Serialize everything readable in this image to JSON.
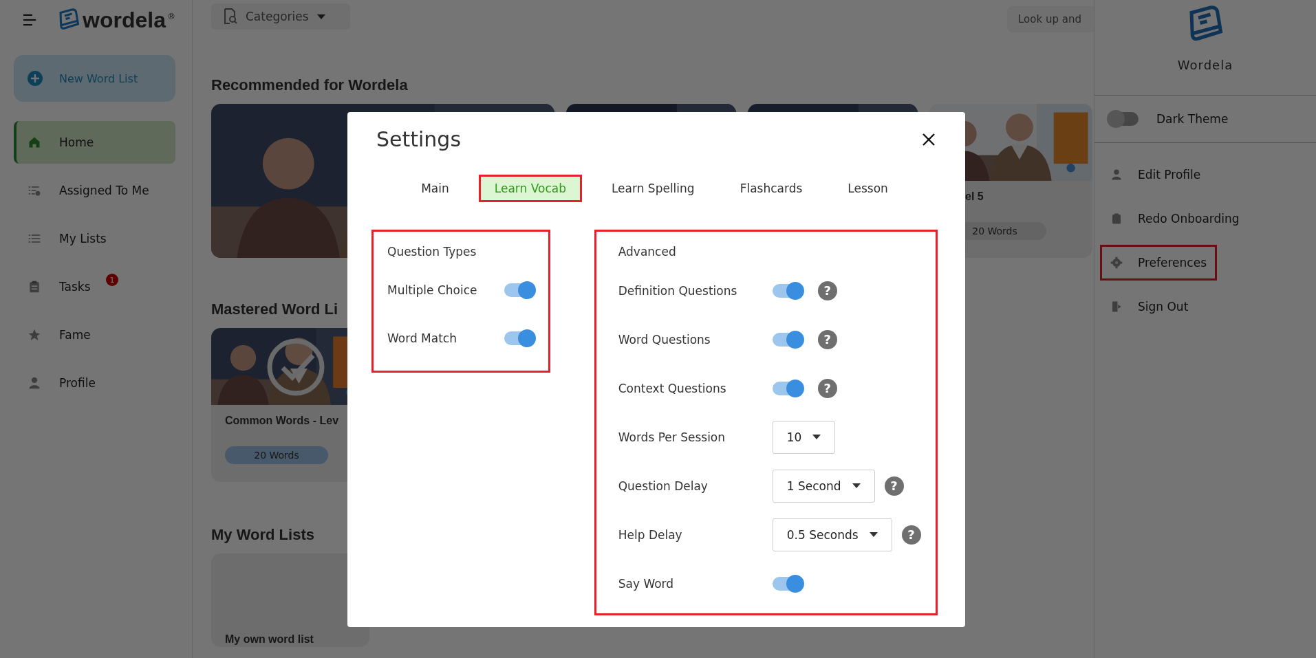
{
  "sidebar": {
    "logo_text": "wordela",
    "logo_mark": "®",
    "new_button": "New Word List",
    "items": [
      {
        "label": "Home",
        "selected": true
      },
      {
        "label": "Assigned To Me",
        "selected": false
      },
      {
        "label": "My Lists",
        "selected": false
      },
      {
        "label": "Tasks",
        "selected": false,
        "badge": "1"
      },
      {
        "label": "Fame",
        "selected": false
      },
      {
        "label": "Profile",
        "selected": false
      }
    ]
  },
  "top_bar": {
    "categories": "Categories",
    "search_placeholder": "Look up and"
  },
  "sections": [
    {
      "heading": "Recommended for Wordela",
      "cards": [
        {
          "kind": "picture"
        },
        {
          "kind": "picture"
        },
        {
          "kind": "picture"
        },
        {
          "kind": "picture",
          "title": "el 5",
          "count": "20 Words"
        }
      ]
    },
    {
      "heading": "Mastered Word Li",
      "cards": [
        {
          "kind": "picture",
          "title": "Common Words - Lev",
          "count": "20 Words",
          "mastered": true
        }
      ]
    },
    {
      "heading": "My Word Lists",
      "cards": [
        {
          "title": "My own word list"
        }
      ]
    }
  ],
  "settings": {
    "title": "Settings",
    "tabs": [
      {
        "label": "Main",
        "selected": false,
        "highlighted": false
      },
      {
        "label": "Learn Vocab",
        "selected": true,
        "highlighted": true
      },
      {
        "label": "Learn Spelling",
        "selected": false,
        "highlighted": false
      },
      {
        "label": "Flashcards",
        "selected": false,
        "highlighted": false
      },
      {
        "label": "Lesson",
        "selected": false,
        "highlighted": false
      }
    ],
    "question_types": {
      "heading": "Question Types",
      "highlighted": true,
      "rows": [
        {
          "kind": "toggle",
          "label": "Multiple Choice",
          "on": true
        },
        {
          "kind": "toggle",
          "label": "Word Match",
          "on": true
        }
      ]
    },
    "advanced": {
      "heading": "Advanced",
      "highlighted": true,
      "rows": [
        {
          "kind": "toggle",
          "label": "Definition Questions",
          "on": true,
          "help": "?"
        },
        {
          "kind": "toggle",
          "label": "Word Questions",
          "on": true,
          "help": "?"
        },
        {
          "kind": "toggle",
          "label": "Context Questions",
          "on": true,
          "help": "?"
        },
        {
          "kind": "select",
          "label": "Words Per Session",
          "value": "10"
        },
        {
          "kind": "select",
          "label": "Question Delay",
          "value": "1 Second",
          "help": "?"
        },
        {
          "kind": "select",
          "label": "Help Delay",
          "value": "0.5 Seconds",
          "help": "?"
        },
        {
          "kind": "toggle",
          "label": "Say Word",
          "on": true
        }
      ]
    }
  },
  "account_panel": {
    "name": "Wordela",
    "dark_theme": {
      "label": "Dark Theme",
      "on": false
    },
    "items": [
      {
        "label": "Edit Profile",
        "highlighted": false
      },
      {
        "label": "Redo Onboarding",
        "highlighted": false
      },
      {
        "label": "Preferences",
        "highlighted": true
      },
      {
        "label": "Sign Out",
        "highlighted": false
      }
    ]
  }
}
